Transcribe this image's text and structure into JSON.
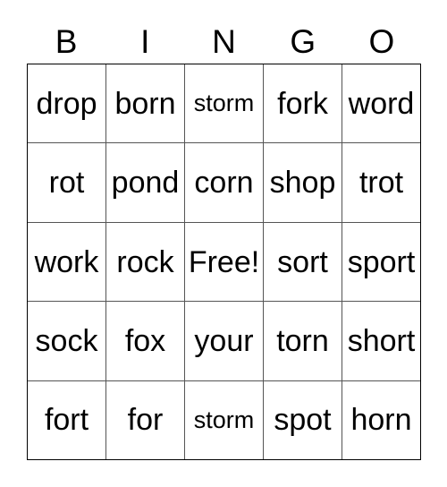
{
  "card": {
    "title": "BINGO",
    "header_letters": [
      "B",
      "I",
      "N",
      "G",
      "O"
    ],
    "free_space_label": "Free!",
    "colors": {
      "background": "#ffffff",
      "text": "#000000",
      "grid_line": "#555555",
      "outer_border": "#000000"
    },
    "rows": [
      {
        "cells": [
          {
            "text": "drop",
            "size": "normal"
          },
          {
            "text": "born",
            "size": "normal"
          },
          {
            "text": "storm",
            "size": "small"
          },
          {
            "text": "fork",
            "size": "normal"
          },
          {
            "text": "word",
            "size": "normal"
          }
        ]
      },
      {
        "cells": [
          {
            "text": "rot",
            "size": "normal"
          },
          {
            "text": "pond",
            "size": "normal"
          },
          {
            "text": "corn",
            "size": "normal"
          },
          {
            "text": "shop",
            "size": "normal"
          },
          {
            "text": "trot",
            "size": "normal"
          }
        ]
      },
      {
        "cells": [
          {
            "text": "work",
            "size": "normal"
          },
          {
            "text": "rock",
            "size": "normal"
          },
          {
            "text": "Free!",
            "size": "normal"
          },
          {
            "text": "sort",
            "size": "normal"
          },
          {
            "text": "sport",
            "size": "normal"
          }
        ]
      },
      {
        "cells": [
          {
            "text": "sock",
            "size": "normal"
          },
          {
            "text": "fox",
            "size": "normal"
          },
          {
            "text": "your",
            "size": "normal"
          },
          {
            "text": "torn",
            "size": "normal"
          },
          {
            "text": "short",
            "size": "normal"
          }
        ]
      },
      {
        "cells": [
          {
            "text": "fort",
            "size": "normal"
          },
          {
            "text": "for",
            "size": "normal"
          },
          {
            "text": "storm",
            "size": "small"
          },
          {
            "text": "spot",
            "size": "normal"
          },
          {
            "text": "horn",
            "size": "normal"
          }
        ]
      }
    ]
  }
}
